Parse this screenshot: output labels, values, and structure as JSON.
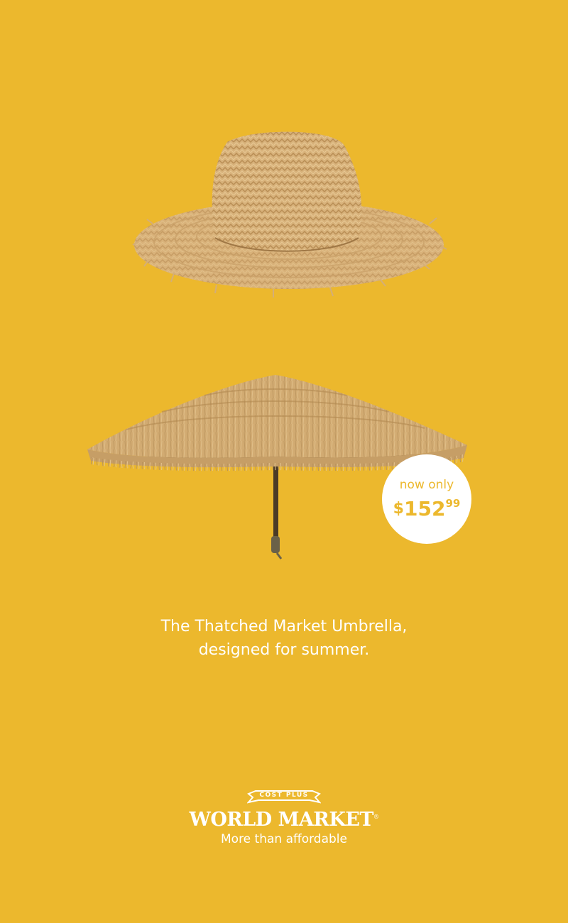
{
  "ad": {
    "background_color": "#ecb82d",
    "hat": {
      "icon": "straw-hat-icon"
    },
    "umbrella": {
      "icon": "thatched-umbrella-icon"
    },
    "price": {
      "prefix": "now only",
      "dollar_sign": "$",
      "whole": "152",
      "cents": "99"
    },
    "tagline": {
      "line1": "The Thatched Market Umbrella,",
      "line2": "designed for summer."
    },
    "brand": {
      "banner_text": "COST PLUS",
      "wordmark": "WORLD MARKET",
      "registered_mark": "®",
      "slogan": "More than affordable"
    }
  }
}
